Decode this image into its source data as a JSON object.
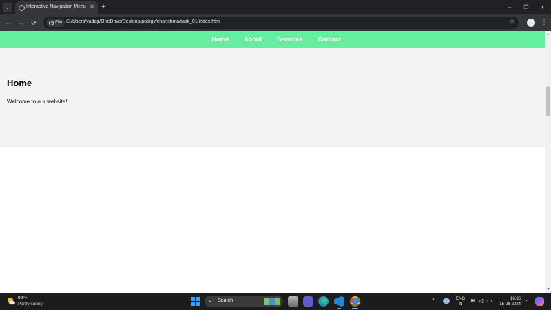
{
  "browser": {
    "tab_title": "Interactive Navigation Menu",
    "tab_close": "✕",
    "new_tab": "+",
    "controls": {
      "minimize": "–",
      "restore": "❐",
      "close": "✕"
    },
    "nav": {
      "back": "←",
      "forward": "→",
      "reload": "⟳"
    },
    "file_chip": "File",
    "url": "C:/Users/yadag/OneDrive/Desktop/podigy/charishma/task_01/index.html",
    "star": "☆",
    "menu": "⋮"
  },
  "site": {
    "nav_links": [
      "Home",
      "About",
      "Services",
      "Contact"
    ],
    "nav_color": "#66ee9f",
    "hero_title": "Home",
    "hero_text": "Welcome to our website!"
  },
  "scrollbar": {
    "up": "▲",
    "down": "▼"
  },
  "taskbar": {
    "weather_temp": "99°F",
    "weather_desc": "Partly sunny",
    "search_label": "Search",
    "search_glyph": "⌕",
    "tray_chevron": "^",
    "lang_line1": "ENG",
    "lang_line2": "IN",
    "time": "16:35",
    "date": "15-06-2024",
    "apps": [
      "file-explorer-icon",
      "teams-icon",
      "edge-icon",
      "vscode-icon",
      "chrome-icon"
    ]
  }
}
